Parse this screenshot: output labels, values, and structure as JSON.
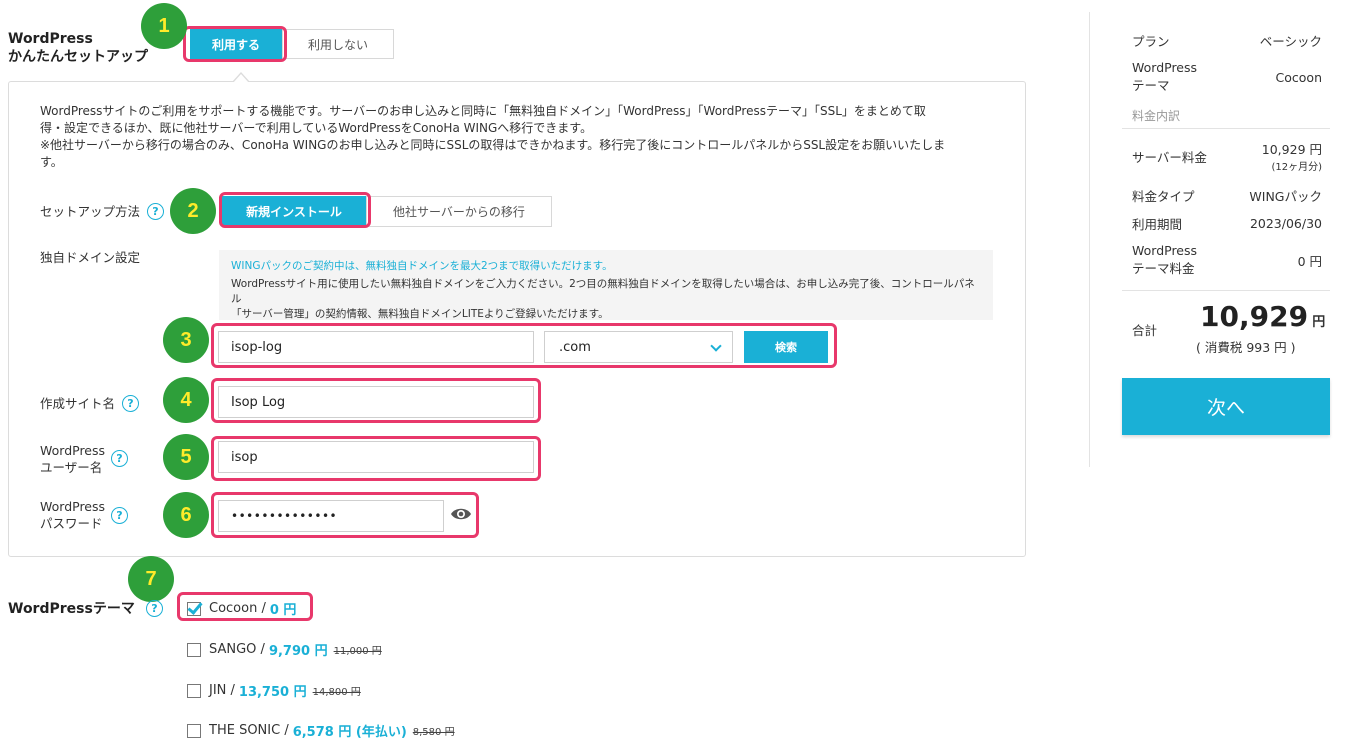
{
  "wp_setup": {
    "title_line1": "WordPress",
    "title_line2": "かんたんセットアップ",
    "use_label": "利用する",
    "nouse_label": "利用しない"
  },
  "description": {
    "line1": "WordPressサイトのご利用をサポートする機能です。サーバーのお申し込みと同時に「無料独自ドメイン」「WordPress」「WordPressテーマ」「SSL」をまとめて取",
    "line2": "得・設定できるほか、既に他社サーバーで利用しているWordPressをConoHa WINGへ移行できます。",
    "line3": "※他社サーバーから移行の場合のみ、ConoHa WINGのお申し込みと同時にSSLの取得はできかねます。移行完了後にコントロールパネルからSSL設定をお願いいたしま",
    "line4": "す。"
  },
  "setup_method": {
    "label": "セットアップ方法",
    "new_install": "新規インストール",
    "migrate": "他社サーバーからの移行"
  },
  "domain": {
    "label": "独自ドメイン設定",
    "note_blue": "WINGパックのご契約中は、無料独自ドメインを最大2つまで取得いただけます。",
    "note_line1": "WordPressサイト用に使用したい無料独自ドメインをご入力ください。2つ目の無料独自ドメインを取得したい場合は、お申し込み完了後、コントロールパネル",
    "note_line2": "「サーバー管理」の契約情報、無料独自ドメインLITEよりご登録いただけます。",
    "value": "isop-log",
    "tld": ".com",
    "search_label": "検索"
  },
  "site_name": {
    "label": "作成サイト名",
    "value": "Isop Log"
  },
  "wp_user": {
    "label_line1": "WordPress",
    "label_line2": "ユーザー名",
    "value": "isop"
  },
  "wp_pass": {
    "label_line1": "WordPress",
    "label_line2": "パスワード",
    "value": "••••••••••••••"
  },
  "theme": {
    "label": "WordPressテーマ",
    "options": [
      {
        "name": "Cocoon / ",
        "price": "0 円",
        "original": "",
        "checked": true
      },
      {
        "name": "SANGO / ",
        "price": "9,790 円",
        "original": "11,000 円",
        "checked": false
      },
      {
        "name": "JIN / ",
        "price": "13,750 円",
        "original": "14,800 円",
        "checked": false
      },
      {
        "name": "THE SONIC / ",
        "price": "6,578 円 (年払い)",
        "original": "8,580 円",
        "checked": false
      }
    ]
  },
  "steps": [
    "1",
    "2",
    "3",
    "4",
    "5",
    "6",
    "7"
  ],
  "summary": {
    "plan_label": "プラン",
    "plan_value": "ベーシック",
    "theme_label_1": "WordPress",
    "theme_label_2": "テーマ",
    "theme_value": "Cocoon",
    "fee_detail": "料金内訳",
    "server_fee_label": "サーバー料金",
    "server_fee_value": "10,929 円",
    "server_fee_sub": "(12ヶ月分)",
    "fee_type_label": "料金タイプ",
    "fee_type_value": "WINGパック",
    "period_label": "利用期間",
    "period_value": "2023/06/30",
    "theme_fee_label_1": "WordPress",
    "theme_fee_label_2": "テーマ料金",
    "theme_fee_value": "0 円",
    "total_label": "合計",
    "total_value": "10,929",
    "total_unit": "円",
    "tax": "( 消費税 993 円 )",
    "next_label": "次へ"
  }
}
